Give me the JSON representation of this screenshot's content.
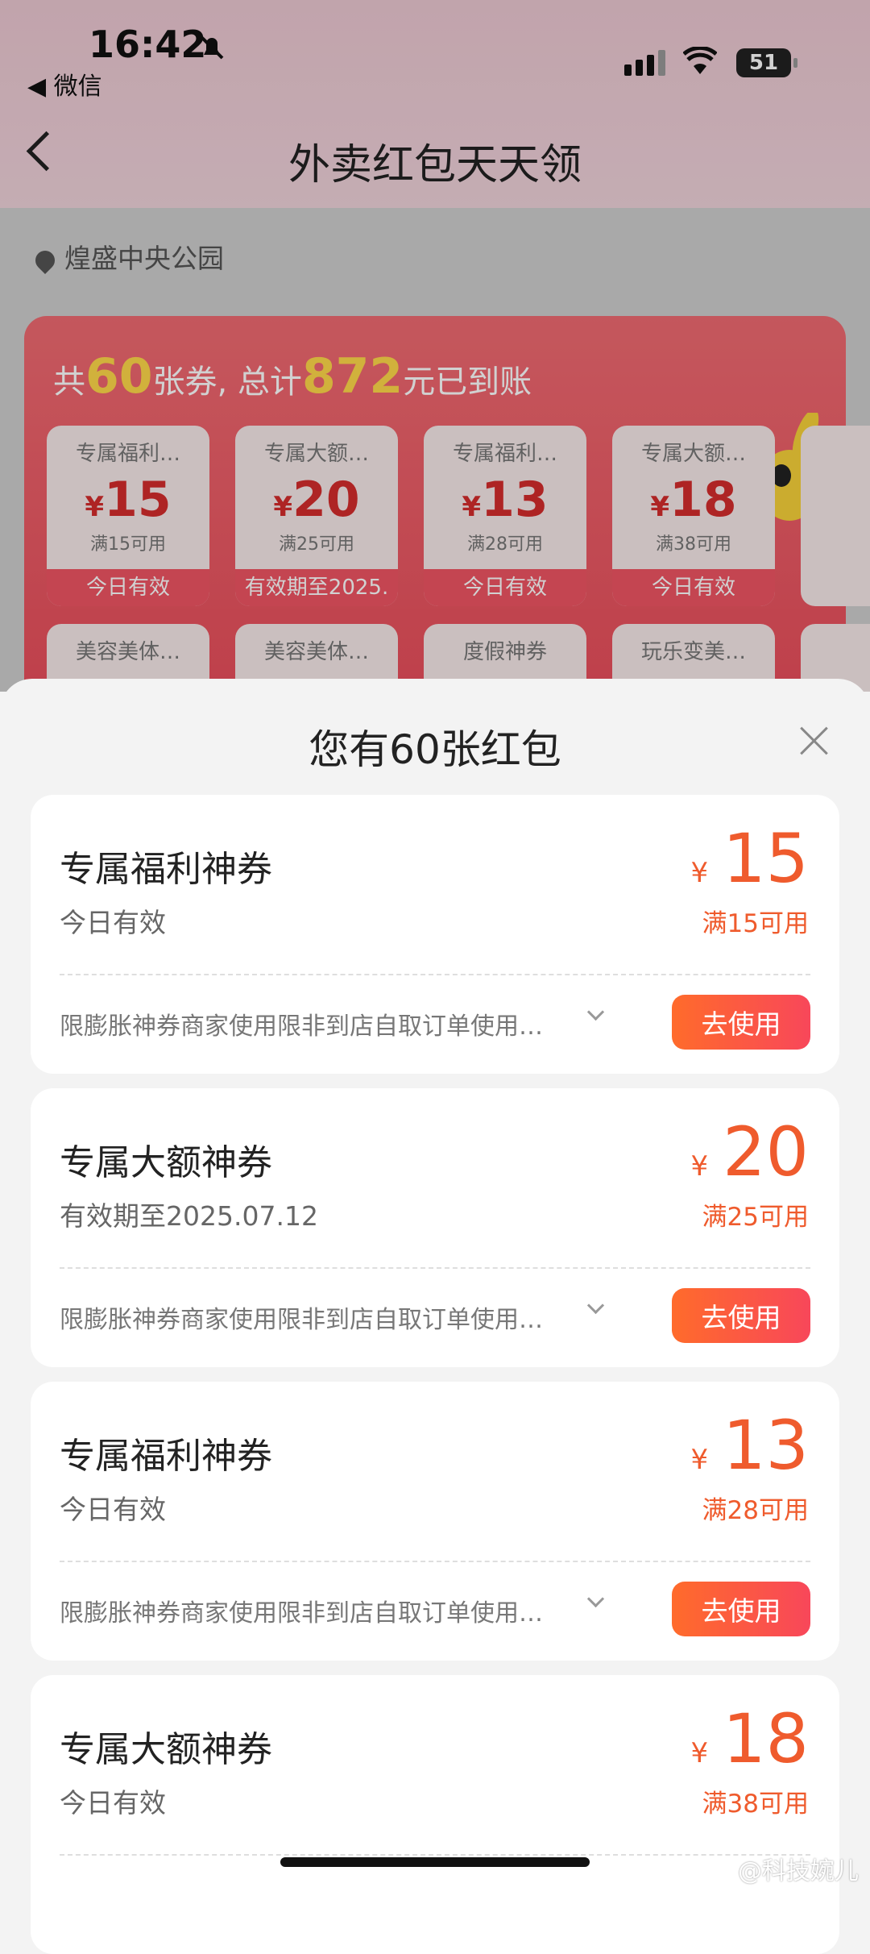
{
  "status": {
    "time": "16:42",
    "back_app": "◀ 微信",
    "battery": "51"
  },
  "nav": {
    "title": "外卖红包天天领"
  },
  "background": {
    "location": "煌盛中央公园",
    "summary_prefix": "共",
    "summary_count": "60",
    "summary_mid": "张券, 总计",
    "summary_total": "872",
    "summary_suffix": "元已到账",
    "mini_coupons": [
      {
        "name": "专属福利…",
        "amount": "15",
        "cond": "满15可用",
        "validity": "今日有效"
      },
      {
        "name": "专属大额…",
        "amount": "20",
        "cond": "满25可用",
        "validity": "有效期至2025."
      },
      {
        "name": "专属福利…",
        "amount": "13",
        "cond": "满28可用",
        "validity": "今日有效"
      },
      {
        "name": "专属大额…",
        "amount": "18",
        "cond": "满38可用",
        "validity": "今日有效"
      }
    ],
    "row2": [
      "美容美体…",
      "美容美体…",
      "度假神券",
      "玩乐变美…"
    ]
  },
  "sheet": {
    "title": "您有60张红包",
    "currency": "¥",
    "use_label": "去使用",
    "coupons": [
      {
        "name": "专属福利神券",
        "validity": "今日有效",
        "amount": "15",
        "cond": "满15可用",
        "rule": "限膨胀神券商家使用限非到店自取订单使用…"
      },
      {
        "name": "专属大额神券",
        "validity": "有效期至2025.07.12",
        "amount": "20",
        "cond": "满25可用",
        "rule": "限膨胀神券商家使用限非到店自取订单使用…"
      },
      {
        "name": "专属福利神券",
        "validity": "今日有效",
        "amount": "13",
        "cond": "满28可用",
        "rule": "限膨胀神券商家使用限非到店自取订单使用…"
      },
      {
        "name": "专属大额神券",
        "validity": "今日有效",
        "amount": "18",
        "cond": "满38可用",
        "rule": ""
      }
    ]
  },
  "watermark": "@科技婉儿"
}
